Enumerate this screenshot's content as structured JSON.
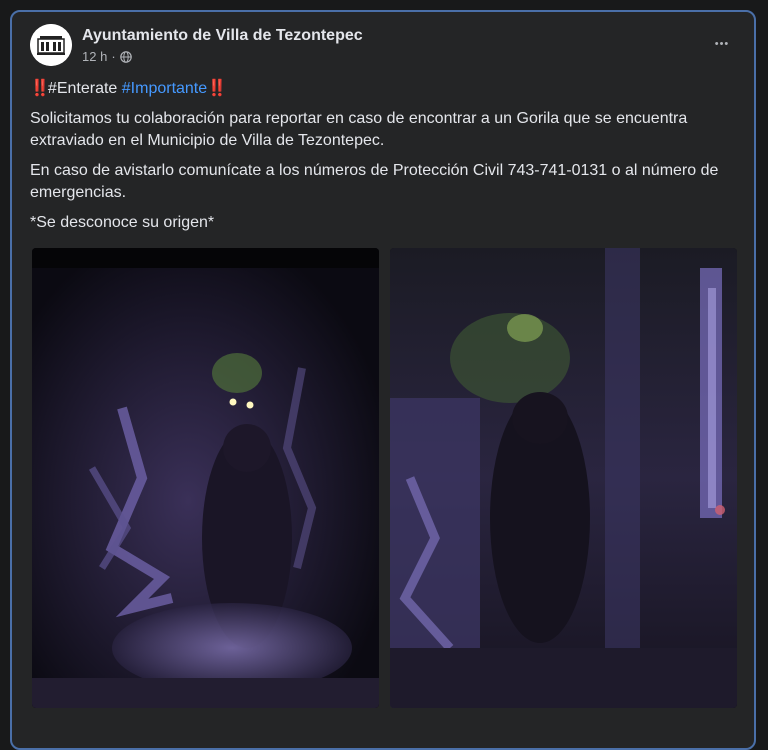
{
  "post": {
    "page_name": "Ayuntamiento de Villa de Tezontepec",
    "time": "12 h",
    "dot": "·",
    "more_label": "•••",
    "icons": {
      "audience": "globe-icon",
      "bang": "‼️"
    },
    "hashtags": {
      "tag1": "#Enterate",
      "tag2": "#Importante"
    },
    "paragraph1": "Solicitamos tu colaboración para reportar en caso de encontrar a un Gorila que se encuentra extraviado en el Municipio de Villa de Tezontepec.",
    "paragraph2": "En caso de avistarlo comunícate a los números de Protección Civil 743-741-0131 o al número de emergencias.",
    "paragraph3": "*Se desconoce su origen*"
  },
  "colors": {
    "background": "#18191a",
    "card": "#242526",
    "card_border": "#4a6fa8",
    "hashtag": "#4599ff",
    "text": "#e4e6eb",
    "muted": "#b0b3b8"
  }
}
